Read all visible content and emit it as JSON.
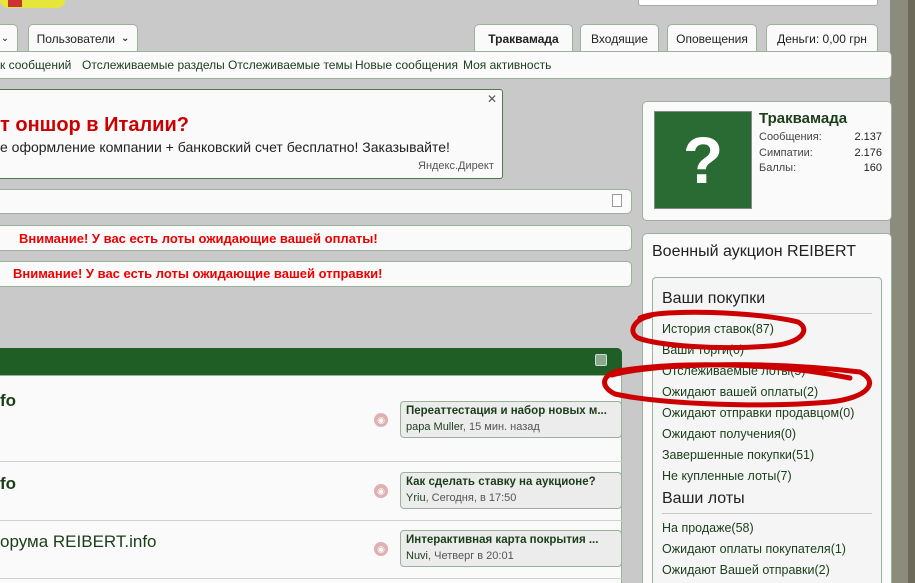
{
  "nav": {
    "tab_users": "Пользователи",
    "tabs": [
      "Траквамада",
      "Входящие",
      "Оповещения",
      "Деньги: 0,00 грн"
    ]
  },
  "subnav": [
    "к сообщений",
    "Отслеживаемые разделы",
    "Отслеживаемые темы",
    "Новые сообщения",
    "Моя активность"
  ],
  "ad": {
    "title": "т оншор в Италии?",
    "text": "е оформление компании + банковский счет бесплатно! Заказывайте!",
    "source": "Яндекс.Директ"
  },
  "warnings": {
    "payment": "Внимание! У вас есть лоты ожидающие вашей оплаты!",
    "shipping": "Внимание! У вас есть лоты ожидающие вашей отправки!"
  },
  "forums": [
    {
      "title": "fo",
      "lp_title": "Переаттестация и набор новых м...",
      "lp_user": "papa Muller",
      "lp_time": ", 15 мин. назад"
    },
    {
      "title": "fo",
      "lp_title": "Как сделать ставку на аукционе?",
      "lp_user": "Yriu",
      "lp_time": ", Сегодня, в 17:50"
    },
    {
      "title": "орума REIBERT.info",
      "lp_title": "Интерактивная карта покрытия ...",
      "lp_user": "Nuvi",
      "lp_time": ", Четверг в 20:01"
    }
  ],
  "profile": {
    "name": "Траквамада",
    "stats": [
      {
        "label": "Сообщения:",
        "value": "2.137"
      },
      {
        "label": "Симпатии:",
        "value": "2.176"
      },
      {
        "label": "Баллы:",
        "value": "160"
      }
    ]
  },
  "auction": {
    "title": "Военный аукцион REIBERT",
    "purchases_title": "Ваши покупки",
    "purchases": [
      "История ставок(87)",
      "Ваши торги(0)",
      "Отслеживаемые лоты(5)",
      "Ожидают вашей оплаты(2)",
      "Ожидают отправки продавцом(0)",
      "Ожидают получения(0)",
      "Завершенные покупки(51)",
      "Не купленные лоты(7)"
    ],
    "lots_title": "Ваши лоты",
    "lots": [
      "На продаже(58)",
      "Ожидают оплаты покупателя(1)",
      "Ожидают Вашей отправки(2)"
    ]
  },
  "colors": {
    "accent": "#1f5e25",
    "warning": "#e00000",
    "annotation": "#cc0000"
  }
}
